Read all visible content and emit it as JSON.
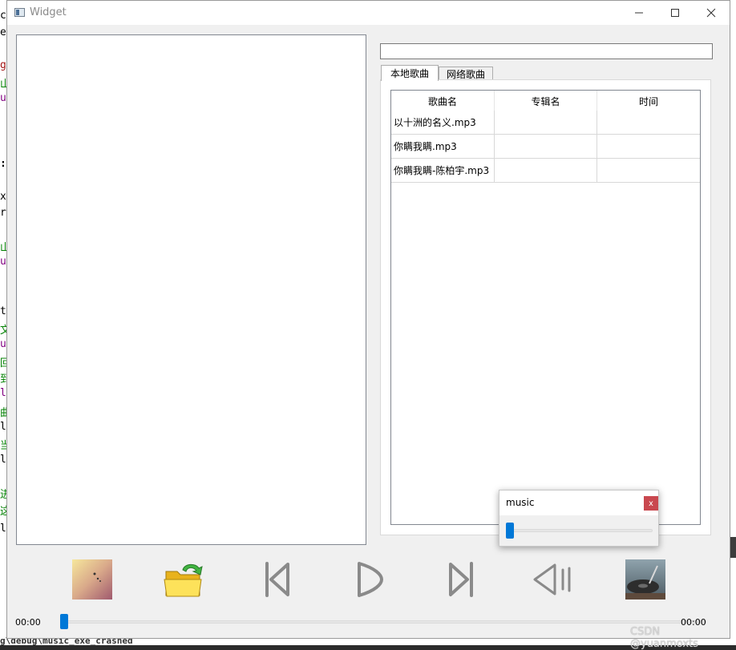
{
  "window": {
    "title": "Widget"
  },
  "background": {
    "editor_glyphs": [
      "c",
      "e",
      "g",
      "山",
      "u",
      ":",
      "x",
      "r",
      "山",
      "u",
      "t",
      "文",
      "u",
      "回",
      "到",
      "l",
      "曲",
      "l",
      "当",
      "l",
      "进",
      "这",
      "l"
    ],
    "terminal_text": "g\\debug\\music_exe_crashed"
  },
  "tabs": [
    {
      "label": "本地歌曲",
      "active": true
    },
    {
      "label": "网络歌曲",
      "active": false
    }
  ],
  "table": {
    "headers": [
      "歌曲名",
      "专辑名",
      "时间"
    ],
    "rows": [
      [
        "以十洲的名义.mp3",
        "",
        ""
      ],
      [
        "你瞒我瞒.mp3",
        "",
        ""
      ],
      [
        "你瞒我瞒-陈柏宇.mp3",
        "",
        ""
      ]
    ]
  },
  "player": {
    "time_elapsed": "00:00",
    "time_total": "00:00",
    "progress_fraction": 0.0
  },
  "volume_popup": {
    "title": "music",
    "close_label": "x",
    "volume_fraction": 0.0
  },
  "watermark": "CSDN @yuanmoxts",
  "colors": {
    "accent": "#0078d7",
    "close_red": "#c9484f"
  },
  "icons": [
    "album-thumbnail-left",
    "open-folder-icon",
    "previous-icon",
    "play-icon",
    "next-icon",
    "volume-icon",
    "album-thumbnail-right"
  ]
}
